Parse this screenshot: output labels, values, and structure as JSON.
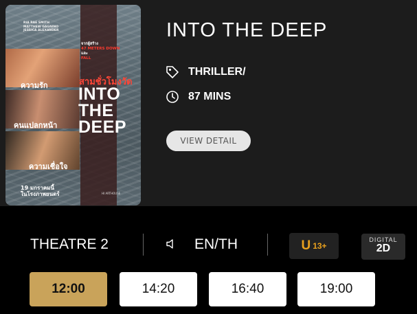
{
  "movie": {
    "title": "INTO THE DEEP",
    "genre": "THRILLER/",
    "duration": "87 MINS",
    "detail_button": "VIEW DETAIL",
    "poster": {
      "credits": [
        "RIA RAE SMITH",
        "MATTHEW GAGNINO",
        "JESSICA ALEXANDER"
      ],
      "tagline": [
        "จากผู้สร้าง",
        "47 METERS DOWN",
        "และ",
        "FALL"
      ],
      "thai_title": "สามชั่วโมงวัด",
      "big_title": [
        "INTO",
        "THE",
        "DEEP"
      ],
      "captions": [
        "ความรัก",
        "คนแปลกหน้า",
        "ความเชื่อใจ"
      ],
      "release": [
        "19 มกราคมนี้",
        "ในโรงภาพยนตร์"
      ],
      "studio": "HI ARTHOUSE"
    }
  },
  "showing": {
    "theatre": "THEATRE 2",
    "language": "EN/TH",
    "rating": {
      "letter": "U",
      "age": "13+"
    },
    "format": {
      "top": "DIGITAL",
      "bottom": "2D"
    }
  },
  "times": [
    "12:00",
    "14:20",
    "16:40",
    "19:00"
  ],
  "selected_time": "12:00",
  "colors": {
    "accent_gold": "#c9a35a",
    "rating_orange": "#e9a11e",
    "background": "#1c1c1c"
  },
  "icons": {
    "genre": "tag-icon",
    "duration": "clock-icon",
    "audio": "speaker-icon"
  }
}
